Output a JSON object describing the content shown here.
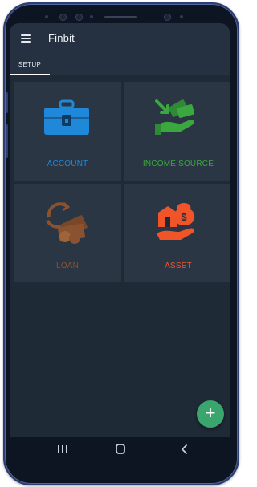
{
  "app": {
    "title": "Finbit"
  },
  "tabs": [
    {
      "label": "SETUP",
      "active": true
    }
  ],
  "tiles": [
    {
      "label": "ACCOUNT",
      "icon": "account-box-icon",
      "color": "#1f88d8"
    },
    {
      "label": "INCOME SOURCE",
      "icon": "income-source-icon",
      "color": "#3aa83f"
    },
    {
      "label": "LOAN",
      "icon": "loan-icon",
      "color": "#8a5230"
    },
    {
      "label": "ASSET",
      "icon": "asset-icon",
      "color": "#f2542a"
    }
  ],
  "fab": {
    "symbol": "+",
    "color": "#3aa66e"
  },
  "nav": {
    "recents_icon": "recents-icon",
    "home_icon": "home-icon",
    "back_icon": "back-icon"
  }
}
